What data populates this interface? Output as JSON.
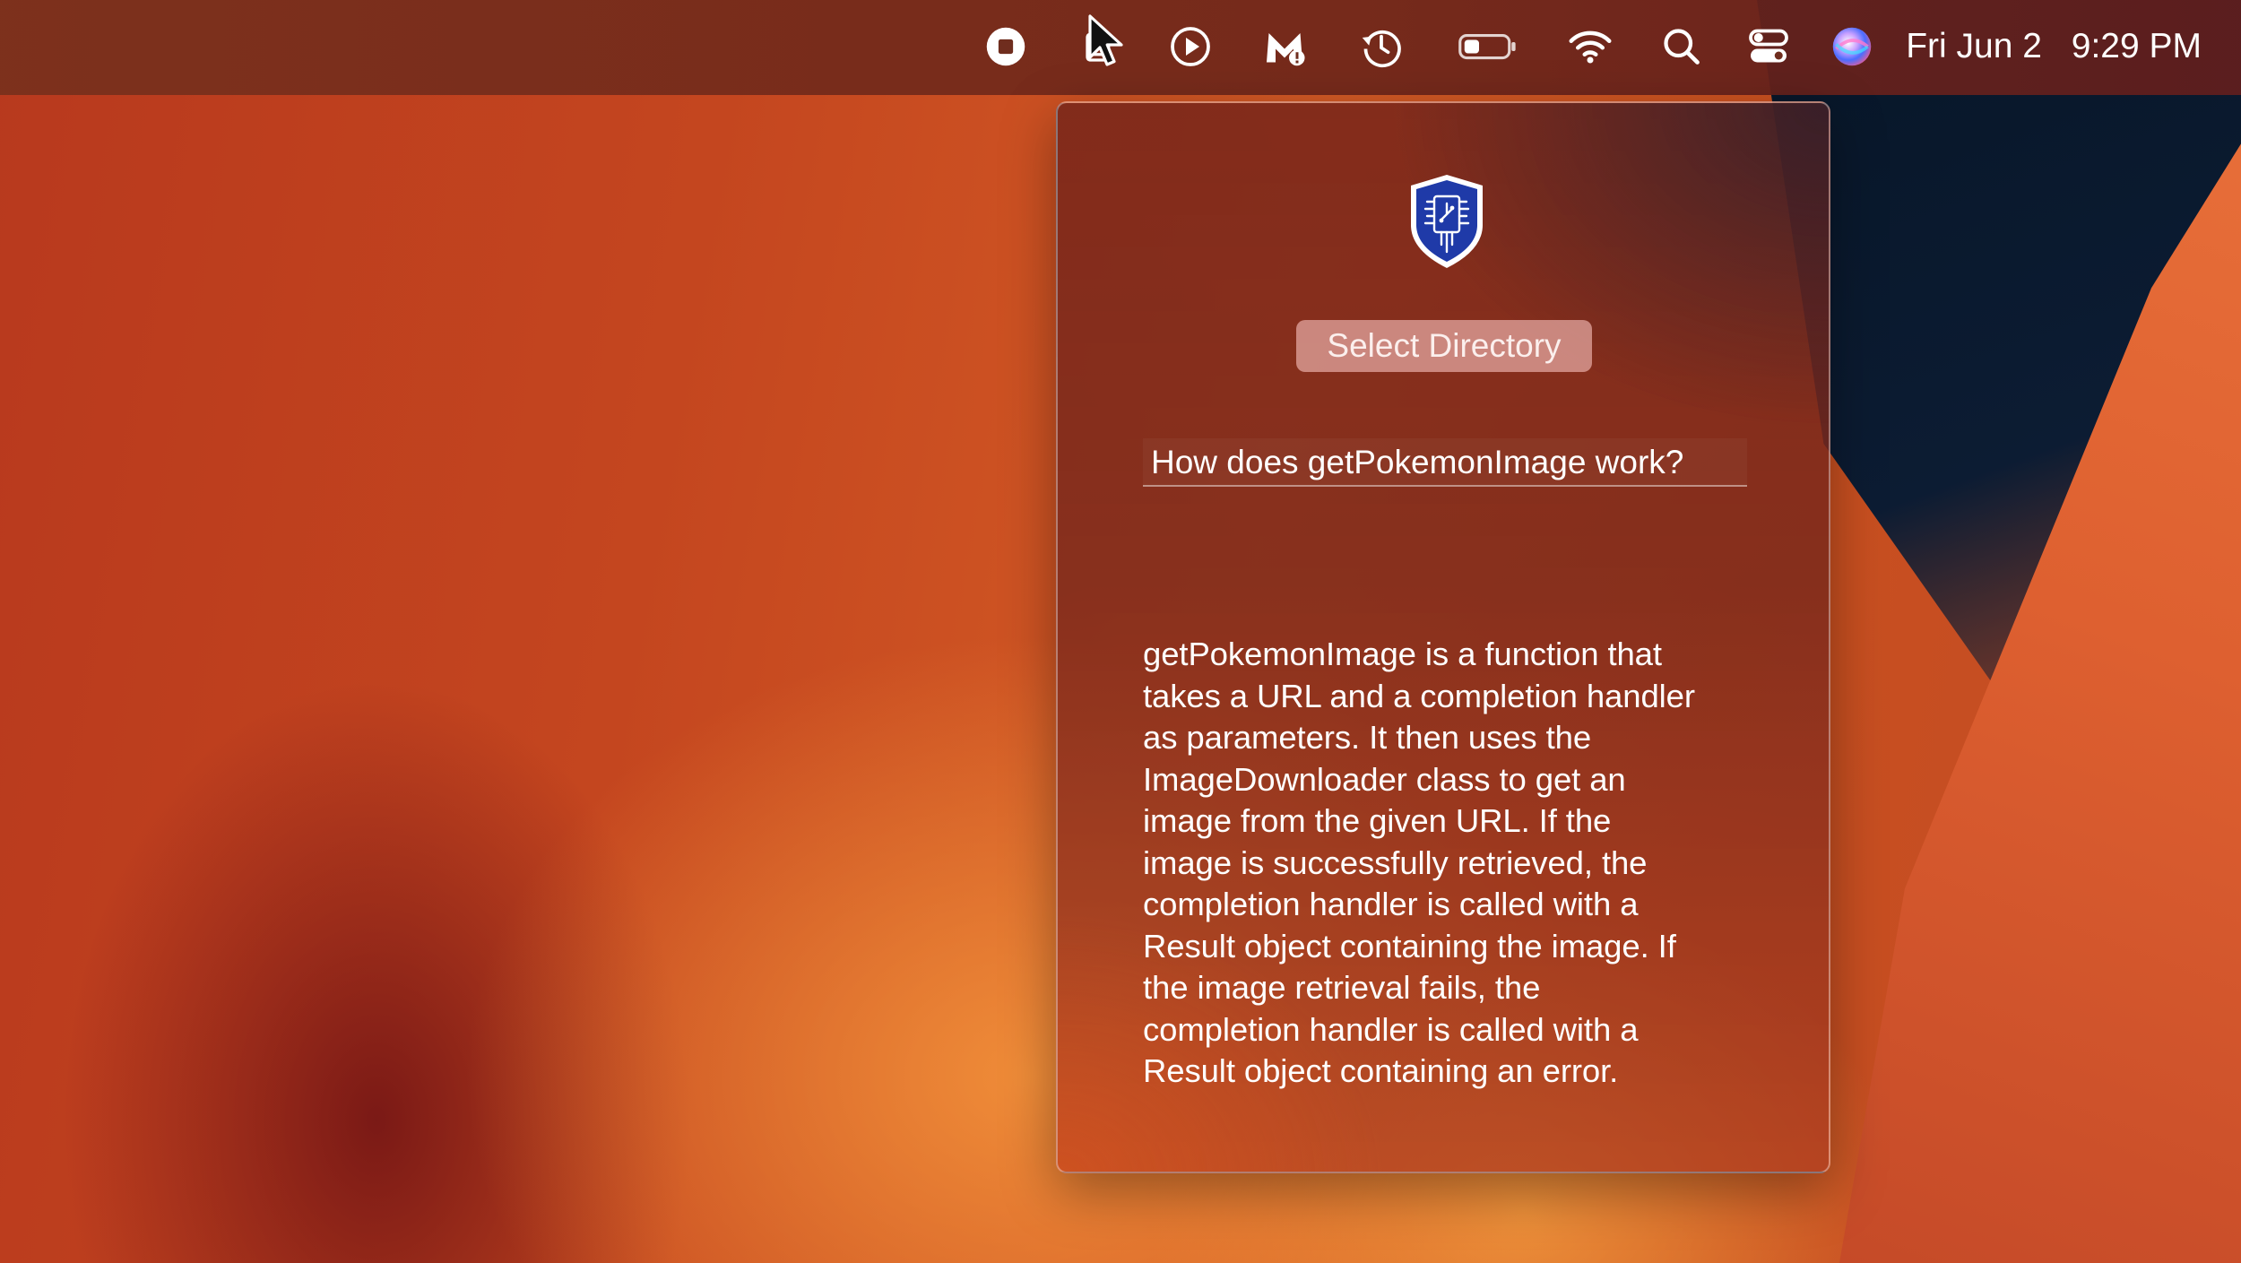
{
  "menubar": {
    "icons": [
      "screen-record-stop-icon",
      "cursor-app-icon",
      "play-icon",
      "malwarebytes-icon",
      "time-machine-icon",
      "battery-icon",
      "wifi-icon",
      "spotlight-search-icon",
      "control-center-icon",
      "siri-icon"
    ],
    "date": "Fri Jun 2",
    "time": "9:29 PM"
  },
  "panel": {
    "logo_icon": "shield-circuit-logo-icon",
    "select_directory_label": "Select Directory",
    "question_value": "How does getPokemonImage work?",
    "answer_lines": [
      "getPokemonImage is a function that",
      "takes a URL and a completion handler",
      "as parameters. It then uses the",
      "ImageDownloader class to get an",
      "image from the given URL. If the",
      "image is successfully retrieved, the",
      "completion handler is called with a",
      "Result object containing the image. If",
      "the image retrieval fails, the",
      "completion handler is called with a",
      "Result object containing an error."
    ]
  },
  "colors": {
    "logo_blue": "#1f3aa8",
    "panel_border": "#f3d2c8",
    "menubar_text": "#ffffff"
  }
}
